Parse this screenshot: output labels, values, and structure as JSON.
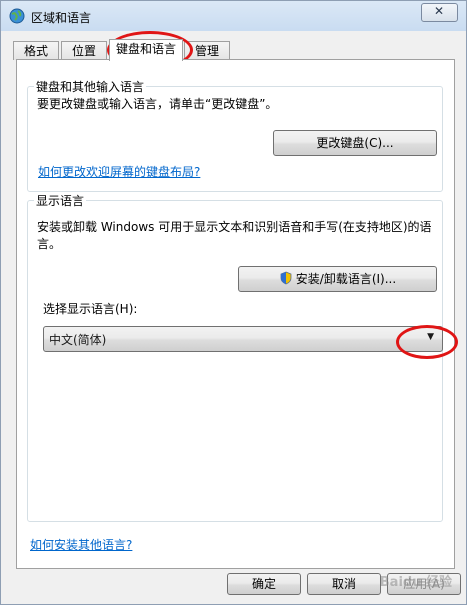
{
  "window": {
    "title": "区域和语言"
  },
  "tabs": [
    {
      "label": "格式"
    },
    {
      "label": "位置"
    },
    {
      "label": "键盘和语言"
    },
    {
      "label": "管理"
    }
  ],
  "keyboard_section": {
    "title": "键盘和其他输入语言",
    "description": "要更改键盘或输入语言，请单击“更改键盘”。",
    "button": "更改键盘(C)...",
    "link": "如何更改欢迎屏幕的键盘布局?"
  },
  "display_section": {
    "title": "显示语言",
    "description_line1": "安装或卸载 Windows 可用于显示文本和识别语音和手写(在支持地区)的语",
    "description_line2": "言。",
    "install_button": "安装/卸载语言(I)...",
    "select_label": "选择显示语言(H):",
    "selected_language": "中文(简体)"
  },
  "footer": {
    "link": "如何安装其他语言?",
    "ok": "确定",
    "cancel": "取消",
    "apply": "应用(A)"
  },
  "colors": {
    "annotation": "#e01515",
    "link": "#0066cc"
  },
  "watermark": "Baidu 经验"
}
